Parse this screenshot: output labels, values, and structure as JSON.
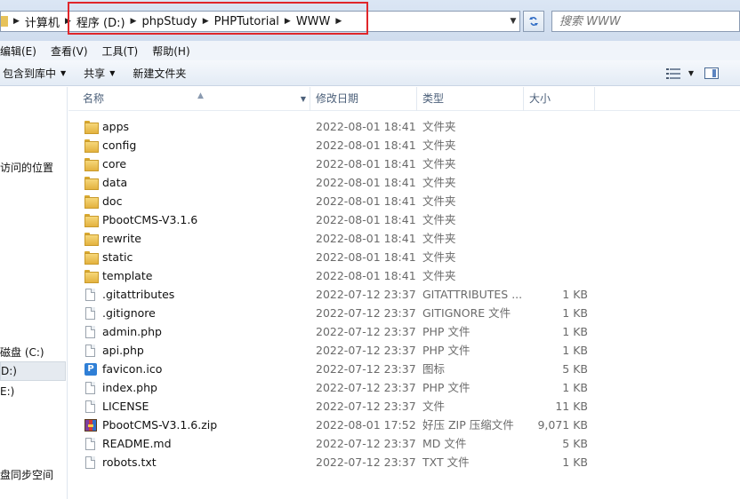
{
  "addressbar": {
    "crumbs": [
      "计算机",
      "程序 (D:)",
      "phpStudy",
      "PHPTutorial",
      "WWW"
    ],
    "search_placeholder": "搜索 WWW"
  },
  "menubar": [
    "编辑(E)",
    "查看(V)",
    "工具(T)",
    "帮助(H)"
  ],
  "toolbar": {
    "include_library": "包含到库中",
    "share": "共享",
    "new_folder": "新建文件夹"
  },
  "navpane": {
    "items": [
      "访问的位置",
      "磁盘 (C:)",
      "D:)",
      "E:)",
      "盘同步空间"
    ]
  },
  "columns": {
    "name": "名称",
    "date": "修改日期",
    "type": "类型",
    "size": "大小"
  },
  "files": [
    {
      "icon": "folder-icon",
      "name": "apps",
      "date": "2022-08-01 18:41",
      "type": "文件夹",
      "size": ""
    },
    {
      "icon": "folder-icon",
      "name": "config",
      "date": "2022-08-01 18:41",
      "type": "文件夹",
      "size": ""
    },
    {
      "icon": "folder-icon",
      "name": "core",
      "date": "2022-08-01 18:41",
      "type": "文件夹",
      "size": ""
    },
    {
      "icon": "folder-icon",
      "name": "data",
      "date": "2022-08-01 18:41",
      "type": "文件夹",
      "size": ""
    },
    {
      "icon": "folder-icon",
      "name": "doc",
      "date": "2022-08-01 18:41",
      "type": "文件夹",
      "size": ""
    },
    {
      "icon": "folder-icon",
      "name": "PbootCMS-V3.1.6",
      "date": "2022-08-01 18:41",
      "type": "文件夹",
      "size": ""
    },
    {
      "icon": "folder-icon",
      "name": "rewrite",
      "date": "2022-08-01 18:41",
      "type": "文件夹",
      "size": ""
    },
    {
      "icon": "folder-icon",
      "name": "static",
      "date": "2022-08-01 18:41",
      "type": "文件夹",
      "size": ""
    },
    {
      "icon": "folder-icon",
      "name": "template",
      "date": "2022-08-01 18:41",
      "type": "文件夹",
      "size": ""
    },
    {
      "icon": "file-icon",
      "name": ".gitattributes",
      "date": "2022-07-12 23:37",
      "type": "GITATTRIBUTES ...",
      "size": "1 KB"
    },
    {
      "icon": "file-icon",
      "name": ".gitignore",
      "date": "2022-07-12 23:37",
      "type": "GITIGNORE 文件",
      "size": "1 KB"
    },
    {
      "icon": "file-icon",
      "name": "admin.php",
      "date": "2022-07-12 23:37",
      "type": "PHP 文件",
      "size": "1 KB"
    },
    {
      "icon": "file-icon",
      "name": "api.php",
      "date": "2022-07-12 23:37",
      "type": "PHP 文件",
      "size": "1 KB"
    },
    {
      "icon": "favicon-icon",
      "name": "favicon.ico",
      "date": "2022-07-12 23:37",
      "type": "图标",
      "size": "5 KB"
    },
    {
      "icon": "file-icon",
      "name": "index.php",
      "date": "2022-07-12 23:37",
      "type": "PHP 文件",
      "size": "1 KB"
    },
    {
      "icon": "file-icon",
      "name": "LICENSE",
      "date": "2022-07-12 23:37",
      "type": "文件",
      "size": "11 KB"
    },
    {
      "icon": "zip-icon",
      "name": "PbootCMS-V3.1.6.zip",
      "date": "2022-08-01 17:52",
      "type": "好压 ZIP 压缩文件",
      "size": "9,071 KB"
    },
    {
      "icon": "file-icon",
      "name": "README.md",
      "date": "2022-07-12 23:37",
      "type": "MD 文件",
      "size": "5 KB"
    },
    {
      "icon": "file-icon",
      "name": "robots.txt",
      "date": "2022-07-12 23:37",
      "type": "TXT 文件",
      "size": "1 KB"
    }
  ],
  "colors": {
    "highlight_box": "#e0262b",
    "folder": "#e3b23f"
  }
}
